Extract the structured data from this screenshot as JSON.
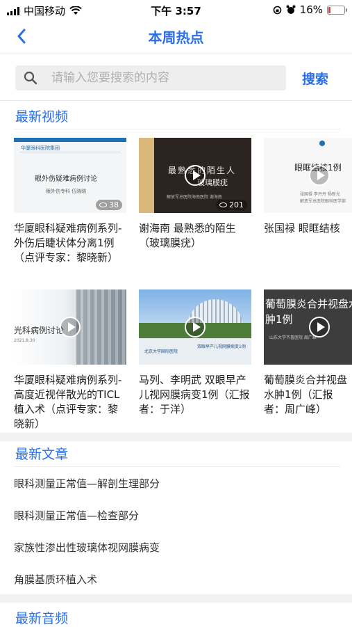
{
  "status": {
    "carrier": "中国移动",
    "time": "下午 3:57",
    "battery": "16%",
    "battery_level": 0.16
  },
  "nav": {
    "title": "本周热点"
  },
  "search": {
    "placeholder": "请输入您要搜索的内容",
    "button": "搜索"
  },
  "sections": {
    "videos": "最新视频",
    "articles": "最新文章",
    "audio": "最新音频"
  },
  "videos": [
    {
      "title": "华厦眼科疑难病例系列-外伤后睫状体分离1例（点评专家：黎晓新）",
      "views": "38",
      "thumb_line1": "华厦眼科医院集团",
      "thumb_line2": "眼外伤疑难病例讨论",
      "thumb_line3": "眼外伤专科  伍晓晓"
    },
    {
      "title": "谢海南 最熟悉的陌生（玻璃膜疣）",
      "views": "201",
      "thumb_line1": "最熟悉的陌生人",
      "thumb_line2": "玻璃膜疣",
      "thumb_line3": "解放军总医院海南医院  谢海南"
    },
    {
      "title": "张国禄 眼眶结核",
      "views": "",
      "thumb_line1": "眼眶结核1例",
      "thumb_line2": "张国禄 李丹丹 杨新光",
      "thumb_line3": "解放军总医院眼科医学部"
    },
    {
      "title": "华厦眼科疑难病例系列-高度近视伴散光的TICL植入术（点评专家：黎晓新）",
      "views": "",
      "thumb_line1": "光科病例讨论",
      "thumb_line2": "2021.8.30",
      "thumb_line3": ""
    },
    {
      "title": "马列、李明武 双眼早产儿视网膜病变1例（汇报者：于洋）",
      "views": "",
      "thumb_line1": "北京大学国际医院",
      "thumb_line2": "双眼早产儿视网膜病变1例",
      "thumb_line3": ""
    },
    {
      "title": "葡萄膜炎合并视盘水肿1例（汇报者：周广峰）",
      "views": "",
      "thumb_line1": "葡萄膜炎合并视盘水",
      "thumb_line2": "肿1例",
      "thumb_line3": "山东大学齐鲁医院  周广峰"
    }
  ],
  "articles": [
    "眼科测量正常值—解剖生理部分",
    "眼科测量正常值—检查部分",
    "家族性渗出性玻璃体视网膜病变",
    "角膜基质环植入术"
  ],
  "icons": {
    "back": "chevron-left-icon",
    "search": "search-icon",
    "play": "play-icon",
    "views": "eye-icon"
  },
  "colors": {
    "accent": "#2a6ee8",
    "battery_low": "#e53935"
  }
}
